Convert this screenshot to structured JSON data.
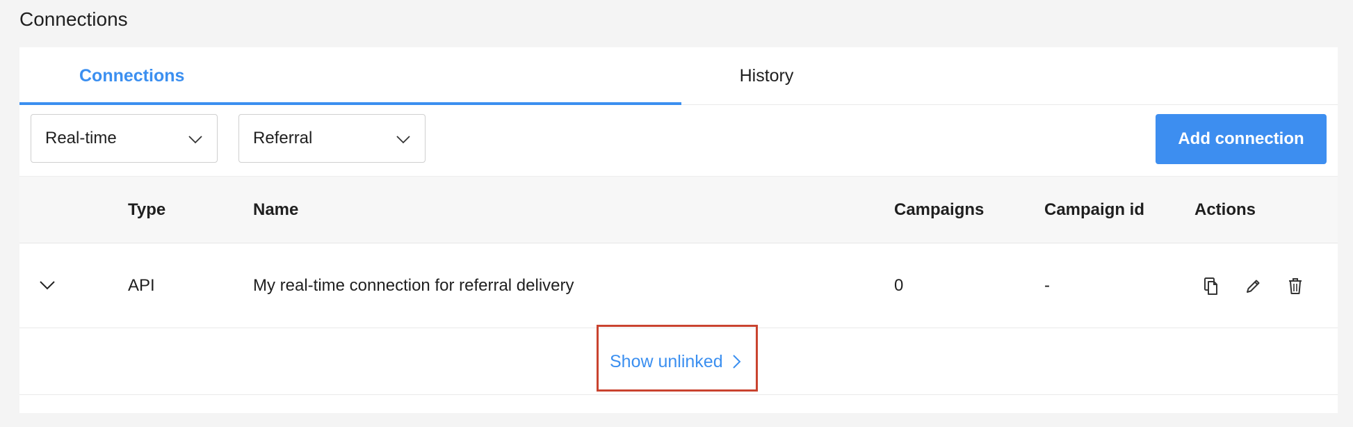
{
  "page": {
    "title": "Connections"
  },
  "tabs": [
    {
      "label": "Connections",
      "active": true
    },
    {
      "label": "History",
      "active": false
    }
  ],
  "filters": {
    "delivery_type": {
      "selected": "Real-time"
    },
    "category": {
      "selected": "Referral"
    }
  },
  "toolbar": {
    "add_label": "Add connection"
  },
  "table": {
    "columns": [
      "Type",
      "Name",
      "Campaigns",
      "Campaign id",
      "Actions"
    ],
    "rows": [
      {
        "type": "API",
        "name": "My real-time connection for referral delivery",
        "campaigns": "0",
        "campaign_id": "-"
      }
    ],
    "show_unlinked_label": "Show unlinked"
  },
  "colors": {
    "accent": "#3b8ff0",
    "highlight": "#c9432f",
    "background": "#f4f4f4"
  },
  "icons": [
    "chevron-down-icon",
    "chevron-right-icon",
    "copy-icon",
    "edit-icon",
    "trash-icon"
  ]
}
